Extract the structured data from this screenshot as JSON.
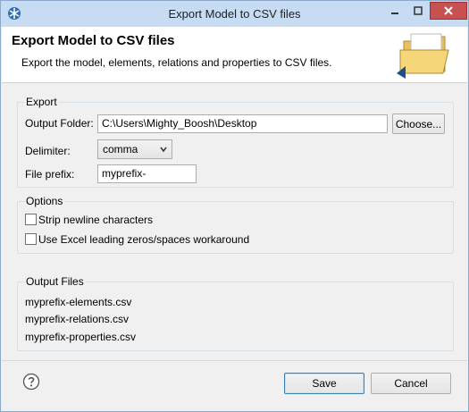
{
  "window": {
    "title": "Export Model to CSV files",
    "icons": {
      "app": "archi-logo-icon",
      "minimize": "minimize-icon",
      "maximize": "maximize-icon",
      "close": "close-icon"
    },
    "colors": {
      "titlebar": "#c7dbf3",
      "close_button": "#c75050",
      "banner": "#ffffff"
    }
  },
  "banner": {
    "title": "Export Model to CSV files",
    "description": "Export the model, elements, relations and properties to CSV files.",
    "icon": "folder-icon"
  },
  "export": {
    "group_label": "Export",
    "output_folder_label": "Output Folder:",
    "output_folder_value": "C:\\Users\\Mighty_Boosh\\Desktop",
    "choose_button": "Choose...",
    "delimiter_label": "Delimiter:",
    "delimiter_value": "comma",
    "file_prefix_label": "File prefix:",
    "file_prefix_value": "myprefix-"
  },
  "options": {
    "group_label": "Options",
    "strip_newline": {
      "label": "Strip newline characters",
      "checked": false
    },
    "excel_workaround": {
      "label": "Use Excel leading zeros/spaces workaround",
      "checked": false
    }
  },
  "output_files": {
    "group_label": "Output Files",
    "files": [
      "myprefix-elements.csv",
      "myprefix-relations.csv",
      "myprefix-properties.csv"
    ]
  },
  "footer": {
    "help_icon": "help-icon",
    "save_label": "Save",
    "cancel_label": "Cancel"
  }
}
